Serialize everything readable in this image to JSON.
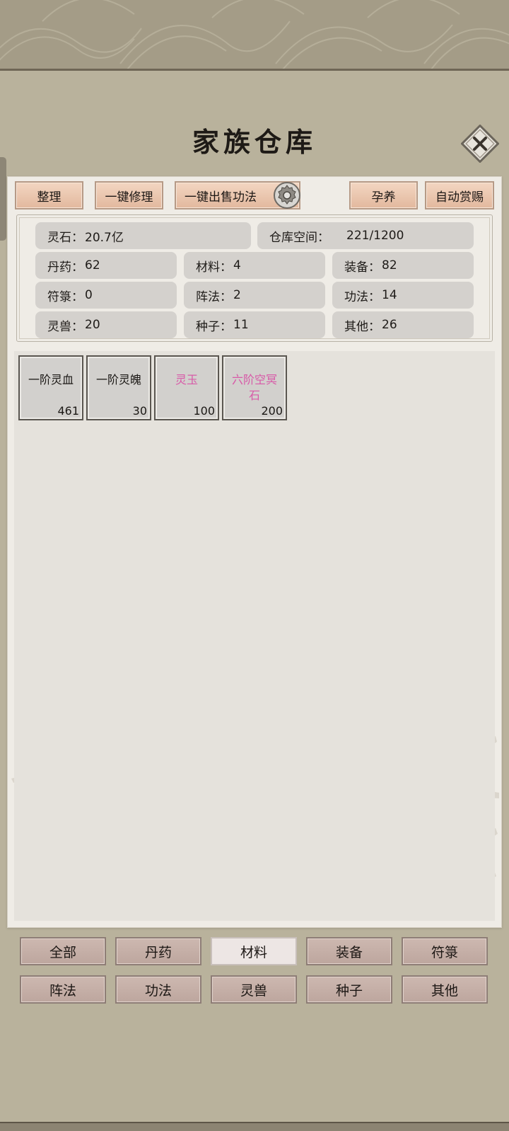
{
  "title": "家族仓库",
  "toolbar": {
    "sort": "整理",
    "repair_all": "一键修理",
    "sell_techniques": "一键出售功法",
    "nurture": "孕养",
    "auto_reward": "自动赏赐"
  },
  "stats": {
    "spirit_stone": {
      "label": "灵石：",
      "value": "20.7亿"
    },
    "storage": {
      "label": "仓库空间：",
      "value": "221/1200"
    },
    "pills": {
      "label": "丹药：",
      "value": "62"
    },
    "materials": {
      "label": "材料：",
      "value": "4"
    },
    "equipment": {
      "label": "装备：",
      "value": "82"
    },
    "talismans": {
      "label": "符箓：",
      "value": "0"
    },
    "formations": {
      "label": "阵法：",
      "value": "2"
    },
    "techniques": {
      "label": "功法：",
      "value": "14"
    },
    "beasts": {
      "label": "灵兽：",
      "value": "20"
    },
    "seeds": {
      "label": "种子：",
      "value": "11"
    },
    "others": {
      "label": "其他：",
      "value": "26"
    }
  },
  "items": [
    {
      "name": "一阶灵血",
      "count": "461",
      "rare": false
    },
    {
      "name": "一阶灵魄",
      "count": "30",
      "rare": false
    },
    {
      "name": "灵玉",
      "count": "100",
      "rare": true
    },
    {
      "name_line1": "六阶空冥",
      "name_line2": "石",
      "count": "200",
      "rare": true
    }
  ],
  "categories": [
    "全部",
    "丹药",
    "材料",
    "装备",
    "符箓",
    "阵法",
    "功法",
    "灵兽",
    "种子",
    "其他"
  ],
  "active_category": "材料",
  "colors": {
    "background": "#b9b29c",
    "panel": "#efece6",
    "toolbar_button": "#e9c4ab",
    "rare_item_text": "#d85aa8",
    "category_button": "#c5afa7"
  }
}
